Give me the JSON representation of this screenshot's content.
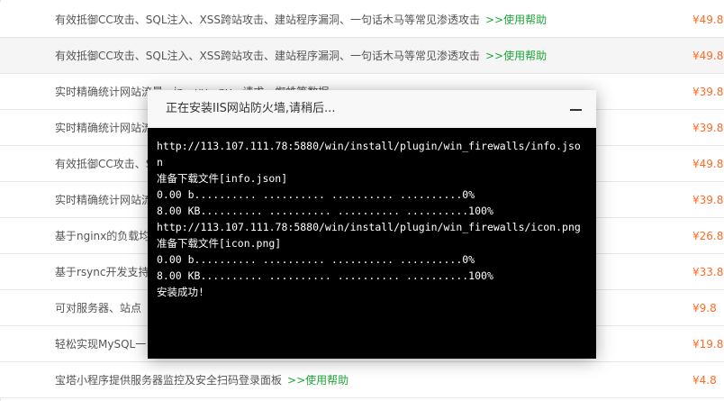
{
  "plugin_table": {
    "rows": [
      {
        "desc": "有效抵御CC攻击、SQL注入、XSS跨站攻击、建站程序漏洞、一句话木马等常见渗透攻击",
        "help": ">>使用帮助",
        "price": "¥49.8"
      },
      {
        "desc": "有效抵御CC攻击、SQL注入、XSS跨站攻击、建站程序漏洞、一句话木马等常见渗透攻击",
        "help": ">>使用帮助",
        "price": "¥49.8"
      },
      {
        "desc": "实时精确统计网站流量、ip、uv、pv、请求、蜘蛛等数据",
        "help": "",
        "price": "¥39.8"
      },
      {
        "desc": "实时精确统计网站流",
        "help": "",
        "price": "¥39.8"
      },
      {
        "desc": "有效抵御CC攻击、S",
        "help": "",
        "price": "¥49.8"
      },
      {
        "desc": "实时精确统计网站流",
        "help": "",
        "price": "¥39.8"
      },
      {
        "desc": "基于nginx的负载均",
        "help": "",
        "price": "¥26.8"
      },
      {
        "desc": "基于rsync开发支持",
        "help": "",
        "price": "¥33.8"
      },
      {
        "desc": "可对服务器、站点",
        "help": "",
        "price": "¥9.8"
      },
      {
        "desc": "轻松实现MySQL一",
        "help": "",
        "price": "¥19.8"
      },
      {
        "desc": "宝塔小程序提供服务器监控及安全扫码登录面板",
        "help": ">>使用帮助",
        "price": "¥4.8"
      }
    ]
  },
  "dialog": {
    "title": "正在安装IIS网站防火墙,请稍后...",
    "minimize_icon": "minimize-icon",
    "console_lines": [
      "http://113.107.111.78:5880/win/install/plugin/win_firewalls/info.jso",
      "n",
      "准备下载文件[info.json]",
      "0.00 b.......... .......... .......... ..........0%",
      "8.00 KB.......... .......... .......... ..........100%",
      "http://113.107.111.78:5880/win/install/plugin/win_firewalls/icon.png",
      "准备下载文件[icon.png]",
      "0.00 b.......... .......... .......... ..........0%",
      "8.00 KB.......... .......... .......... ..........100%",
      "安装成功!"
    ]
  },
  "colors": {
    "help_link": "#20a53a",
    "price": "#fc6d26",
    "console_bg": "#000000",
    "console_text": "#ffffff"
  }
}
